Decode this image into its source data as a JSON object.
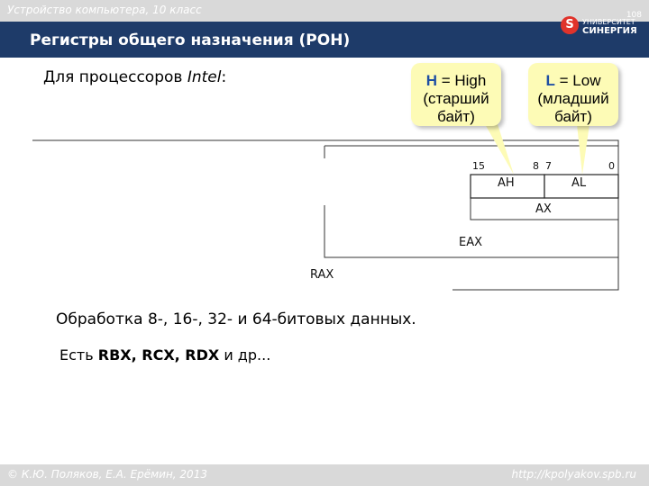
{
  "header": {
    "course": "Устройство компьютера, 10 класс",
    "page_number": "108",
    "title": "Регистры общего назначения (РОН)",
    "logo_line1": "УНИВЕРСИТЕТ",
    "logo_line2": "СИНЕРГИЯ",
    "logo_mark": "S"
  },
  "intro": {
    "text": "Для процессоров ",
    "processor": "Intel",
    "colon": ":"
  },
  "callouts": [
    {
      "key": "H",
      "rest": " = High",
      "line2": "(старший",
      "line3": "байт)"
    },
    {
      "key": "L",
      "rest": " = Low",
      "line2": "(младший",
      "line3": "байт)"
    }
  ],
  "register_diagram": {
    "bits": [
      "15",
      "8",
      "7",
      "0"
    ],
    "ah": "AH",
    "al": "AL",
    "ax": "AX",
    "eax": "EAX",
    "rax": "RAX"
  },
  "body": {
    "line1": "Обработка 8-, 16-, 32- и 64-битовых данных.",
    "line2_prefix": "Есть ",
    "line2_bold": "RBX, RCX, RDX",
    "line2_suffix": " и др..."
  },
  "footer": {
    "copyright": "© К.Ю. Поляков, Е.А. Ерёмин, 2013",
    "site": "http://kpolyakov.spb.ru"
  },
  "colors": {
    "title_bar": "#1e3b69",
    "footer_bar": "#d9d9d9",
    "callout_fill": "#fdfbb6",
    "callout_key": "#1f4fa3",
    "logo_red": "#e0332b"
  }
}
